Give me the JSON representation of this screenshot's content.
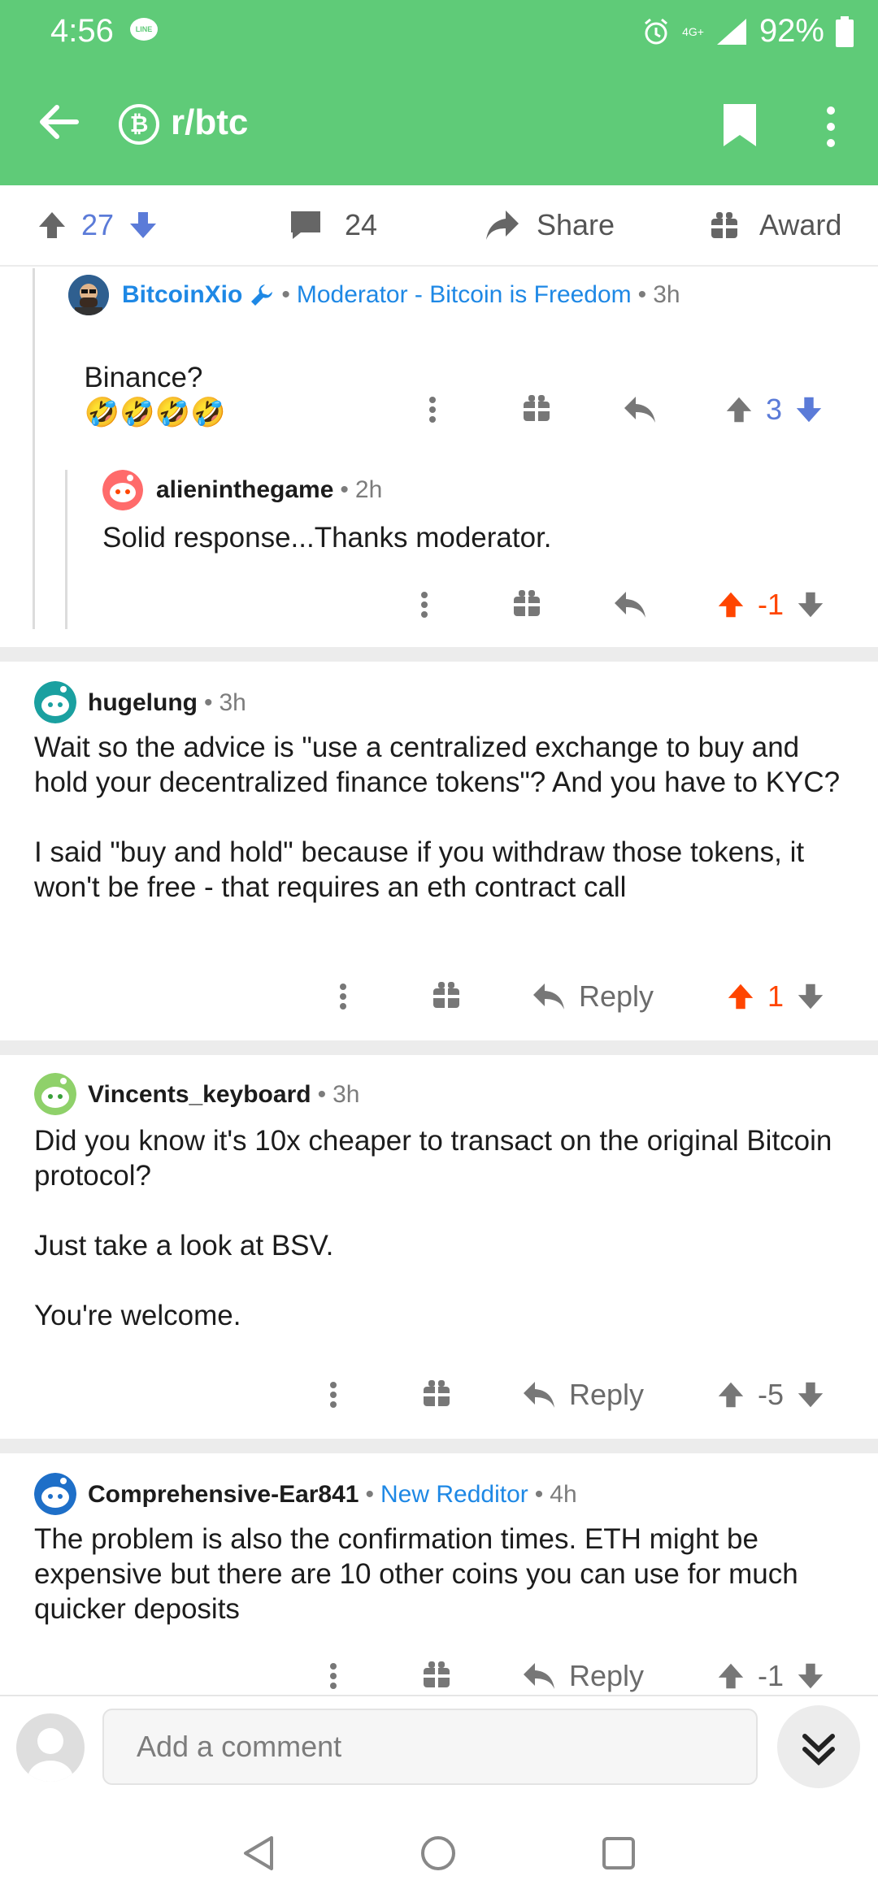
{
  "status": {
    "time": "4:56",
    "line_badge": "LINE",
    "network": "4G+",
    "battery": "92%"
  },
  "header": {
    "subreddit": "r/btc",
    "sub_icon_glyph": "₿"
  },
  "post_actions": {
    "upvotes": "27",
    "comments": "24",
    "share": "Share",
    "award": "Award"
  },
  "comments": [
    {
      "user": "BitcoinXio",
      "flair": "Moderator - Bitcoin is Freedom",
      "dot": "•",
      "age": "3h",
      "text": "Binance?",
      "emojis": "🤣🤣🤣🤣",
      "score": "3"
    },
    {
      "user": "alieninthegame",
      "dot": "•",
      "age": "2h",
      "text": "Solid response...Thanks moderator.",
      "score": "-1"
    },
    {
      "user": "hugelung",
      "dot": "•",
      "age": "3h",
      "text": "Wait so the advice is \"use a centralized exchange to buy and hold your decentralized finance tokens\"? And you have to KYC?\n\nI said \"buy and hold\" because if you withdraw those tokens, it won't be free - that requires an eth contract call",
      "reply": "Reply",
      "score": "1"
    },
    {
      "user": "Vincents_keyboard",
      "dot": "•",
      "age": "3h",
      "text": "Did you know it's 10x cheaper to transact on the original Bitcoin protocol?\n\nJust take a look at BSV.\n\nYou're welcome.",
      "reply": "Reply",
      "score": "-5"
    },
    {
      "user": "Comprehensive-Ear841",
      "flair": "New Redditor",
      "dot": "•",
      "age": "4h",
      "text": "The problem is also the confirmation times. ETH might be expensive but there are 10 other coins you can use for much quicker deposits",
      "reply": "Reply",
      "score": "-1"
    }
  ],
  "composer": {
    "placeholder": "Add a comment"
  },
  "colors": {
    "app_green": "#5fcb78",
    "upvote_orange": "#ff4500",
    "downvote_blue": "#5b7bd8",
    "moderator_blue": "#1e88e5"
  }
}
